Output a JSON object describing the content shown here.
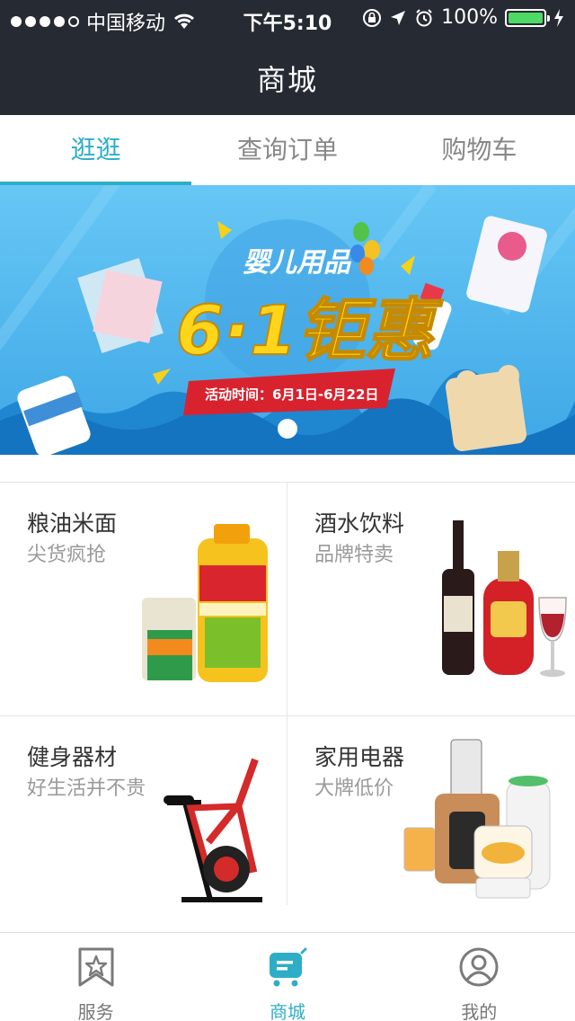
{
  "status_bar": {
    "carrier": "中国移动",
    "time": "下午5:10",
    "battery": "100%"
  },
  "nav": {
    "title": "商城"
  },
  "tabs": [
    {
      "label": "逛逛",
      "active": true
    },
    {
      "label": "查询订单",
      "active": false
    },
    {
      "label": "购物车",
      "active": false
    }
  ],
  "banner": {
    "headline": "婴儿用品",
    "promo": "6·1钜惠",
    "date_range": "活动时间：6月1日-6月22日",
    "current_page": 1
  },
  "categories": [
    {
      "title": "粮油米面",
      "subtitle": "尖货疯抢"
    },
    {
      "title": "酒水饮料",
      "subtitle": "品牌特卖"
    },
    {
      "title": "健身器材",
      "subtitle": "好生活并不贵"
    },
    {
      "title": "家用电器",
      "subtitle": "大牌低价"
    }
  ],
  "bottom_tabs": [
    {
      "label": "服务",
      "icon": "bookmark-star-icon",
      "active": false
    },
    {
      "label": "商城",
      "icon": "cart-icon",
      "active": true
    },
    {
      "label": "我的",
      "icon": "user-icon",
      "active": false
    }
  ],
  "colors": {
    "accent": "#2eaec6",
    "nav_bg": "#262a33",
    "banner_bg": "#4fb8ee"
  }
}
